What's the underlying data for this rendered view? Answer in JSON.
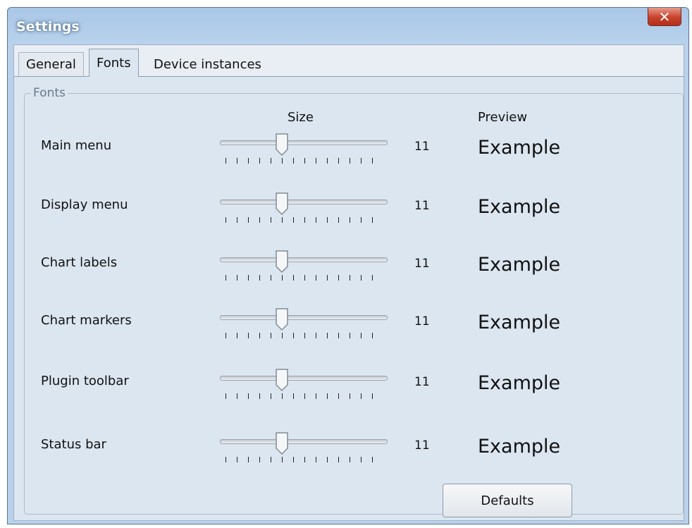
{
  "window": {
    "title": "Settings",
    "close_symbol": "✕",
    "close_icon": "close-icon"
  },
  "tabs": [
    {
      "label": "General"
    },
    {
      "label": "Fonts",
      "active": true
    },
    {
      "label": "Device instances"
    }
  ],
  "fonts_group": {
    "title": "Fonts",
    "size_header": "Size",
    "preview_header": "Preview",
    "slider_level_fraction": 0.357,
    "rows": [
      {
        "label": "Main menu",
        "value": "11",
        "preview": "Example"
      },
      {
        "label": "Display menu",
        "value": "11",
        "preview": "Example"
      },
      {
        "label": "Chart labels",
        "value": "11",
        "preview": "Example"
      },
      {
        "label": "Chart markers",
        "value": "11",
        "preview": "Example"
      },
      {
        "label": "Plugin toolbar",
        "value": "11",
        "preview": "Example"
      },
      {
        "label": "Status bar",
        "value": "11",
        "preview": "Example"
      }
    ],
    "defaults_label": "Defaults"
  },
  "colors": {
    "title_bar": "#b9d1ea",
    "close_button": "#c8412b",
    "client_bg": "#dce6f0"
  }
}
